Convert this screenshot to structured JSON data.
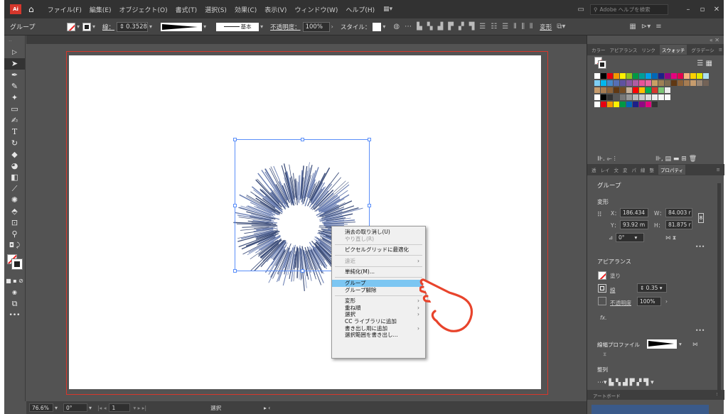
{
  "menubar": {
    "logo": "Ai",
    "items": [
      "ファイル(F)",
      "編集(E)",
      "オブジェクト(O)",
      "書式(T)",
      "選択(S)",
      "効果(C)",
      "表示(V)",
      "ウィンドウ(W)",
      "ヘルプ(H)"
    ],
    "search_placeholder": "Adobe ヘルプを検索"
  },
  "control": {
    "object_type": "グループ",
    "stroke_label": "線：",
    "stroke_weight": "0.3528",
    "brush_label": "基本",
    "opacity_label": "不透明度：",
    "opacity_value": "100%",
    "style_label": "スタイル：",
    "transform_label": "変形"
  },
  "context_menu": {
    "items": [
      {
        "label": "消去の取り消し(U)",
        "disabled": false,
        "submenu": false
      },
      {
        "label": "やり直し(R)",
        "disabled": true,
        "submenu": false
      },
      {
        "sep": true
      },
      {
        "label": "ピクセルグリッドに最適化",
        "disabled": false,
        "submenu": false
      },
      {
        "sep": true
      },
      {
        "label": "遠近",
        "disabled": true,
        "submenu": true
      },
      {
        "sep": true
      },
      {
        "label": "単純化(M)...",
        "disabled": false,
        "submenu": false
      },
      {
        "sep": true
      },
      {
        "label": "グループ",
        "disabled": false,
        "submenu": false,
        "highlighted": true
      },
      {
        "label": "グループ解除",
        "disabled": false,
        "submenu": false
      },
      {
        "sep": true
      },
      {
        "label": "変形",
        "disabled": false,
        "submenu": true
      },
      {
        "label": "重ね順",
        "disabled": false,
        "submenu": true
      },
      {
        "label": "選択",
        "disabled": false,
        "submenu": true
      },
      {
        "label": "CC ライブラリに追加",
        "disabled": false,
        "submenu": false
      },
      {
        "label": "書き出し用に追加",
        "disabled": false,
        "submenu": true
      },
      {
        "label": "選択範囲を書き出し...",
        "disabled": false,
        "submenu": false
      }
    ]
  },
  "status": {
    "zoom": "76.6%",
    "rotation": "0°",
    "artboard_num": "1",
    "tool": "選択"
  },
  "panels": {
    "top_tabs": [
      "カラー",
      "アピアランス",
      "リンク",
      "スウォッチ",
      "グラデーシ"
    ],
    "top_active": "スウォッチ",
    "mid_tabs": [
      "透",
      "レイ",
      "文",
      "変",
      "パ",
      "線",
      "整",
      "プロパティ"
    ],
    "mid_active": "プロパティ",
    "properties": {
      "title": "グループ",
      "transform_title": "変形",
      "x_label": "X：",
      "x_value": "186.434",
      "y_label": "Y：",
      "y_value": "93.92 m",
      "w_label": "W：",
      "w_value": "84.003 r",
      "h_label": "H：",
      "h_value": "81.875 r",
      "angle_value": "0°",
      "appearance_title": "アピアランス",
      "fill_label": "塗り",
      "stroke_label": "線",
      "stroke_value": "0.35",
      "opacity_label": "不透明度",
      "opacity_value": "100%",
      "fx_label": "fx.",
      "profile_label": "線幅プロファイル",
      "align_title": "整列"
    },
    "artboard_tab": "アートボード"
  },
  "colors": {
    "accent_red": "#d6372c",
    "selection_blue": "#5b8ff9",
    "menu_highlight": "#7cc6f2",
    "burst_stroke": "#3d4e7a",
    "hand": "#e8442c"
  }
}
